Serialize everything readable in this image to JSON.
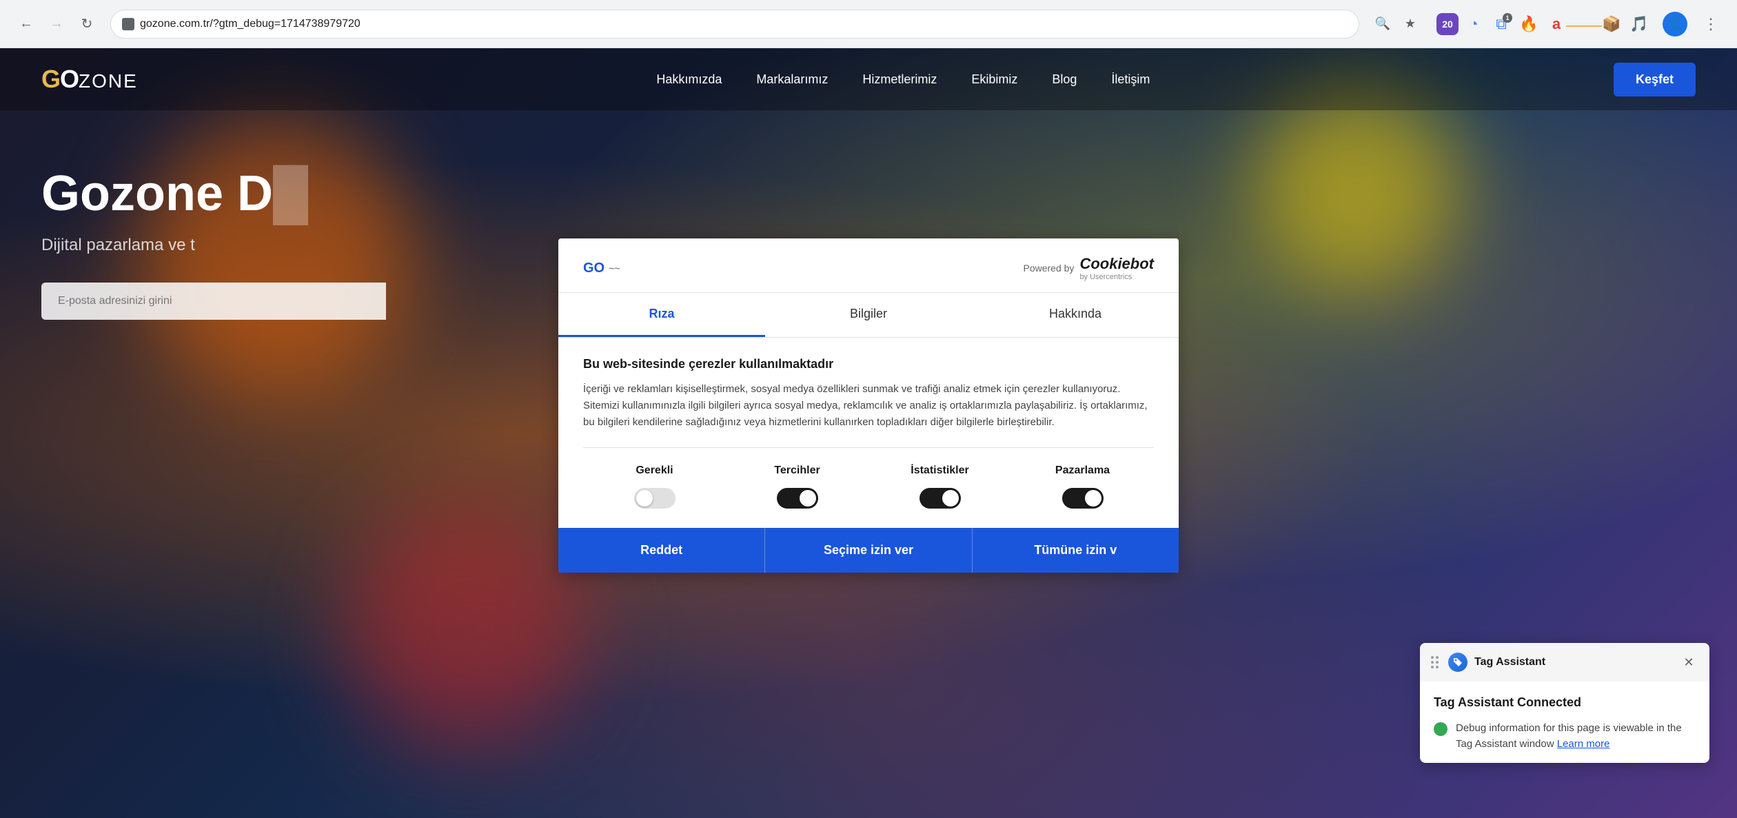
{
  "browser": {
    "url": "gozone.com.tr/?gtm_debug=1714738979720",
    "back_disabled": false,
    "forward_disabled": true
  },
  "website": {
    "logo": "GOZONE",
    "nav": {
      "hakkimizda": "Hakkımızda",
      "markalarimiz": "Markalarımız",
      "hizmetlerimiz": "Hizmetlerimiz",
      "ekibimiz": "Ekibimiz",
      "blog": "Blog",
      "iletisim": "İletişim",
      "kesfet": "Keşfet"
    },
    "hero": {
      "title": "Gozone D",
      "subtitle": "Dijital pazarlama ve t",
      "input_placeholder": "E-posta adresinizi girini"
    }
  },
  "cookie_modal": {
    "powered_by": "Powered by",
    "cookiebot_name": "Cookiebot",
    "cookiebot_sub": "by Usercentrics",
    "tabs": [
      {
        "id": "riza",
        "label": "Rıza",
        "active": true
      },
      {
        "id": "bilgiler",
        "label": "Bilgiler",
        "active": false
      },
      {
        "id": "hakkinda",
        "label": "Hakkında",
        "active": false
      }
    ],
    "body": {
      "title": "Bu web-sitesinde çerezler kullanılmaktadır",
      "description": "İçeriği ve reklamları kişiselleştirmek, sosyal medya özellikleri sunmak ve trafiği analiz etmek için çerezler kullanıyoruz. Sitemizi kullanımınızla ilgili bilgileri ayrıca sosyal medya, reklamcılık ve analiz iş ortaklarımızla paylaşabiliriz. İş ortaklarımız, bu bilgileri kendilerine sağladığınız veya hizmetlerini kullanırken topladıkları diğer bilgilerle birleştirebilir."
    },
    "toggles": [
      {
        "id": "gerekli",
        "label": "Gerekli",
        "state": "off"
      },
      {
        "id": "tercihler",
        "label": "Tercihler",
        "state": "on"
      },
      {
        "id": "istatistikler",
        "label": "İstatistikler",
        "state": "on"
      },
      {
        "id": "pazarlama",
        "label": "Pazarlama",
        "state": "on"
      }
    ],
    "buttons": [
      {
        "id": "reddet",
        "label": "Reddet"
      },
      {
        "id": "secim",
        "label": "Seçime izin ver"
      },
      {
        "id": "tumune",
        "label": "Tümüne izin v"
      }
    ]
  },
  "tag_assistant": {
    "title": "Tag Assistant",
    "connected_title": "Tag Assistant Connected",
    "status_text": "Debug information for this page is viewable in the Tag Assistant window",
    "learn_more": "Learn more",
    "drag_handle_label": "drag handle",
    "close_label": "close"
  }
}
